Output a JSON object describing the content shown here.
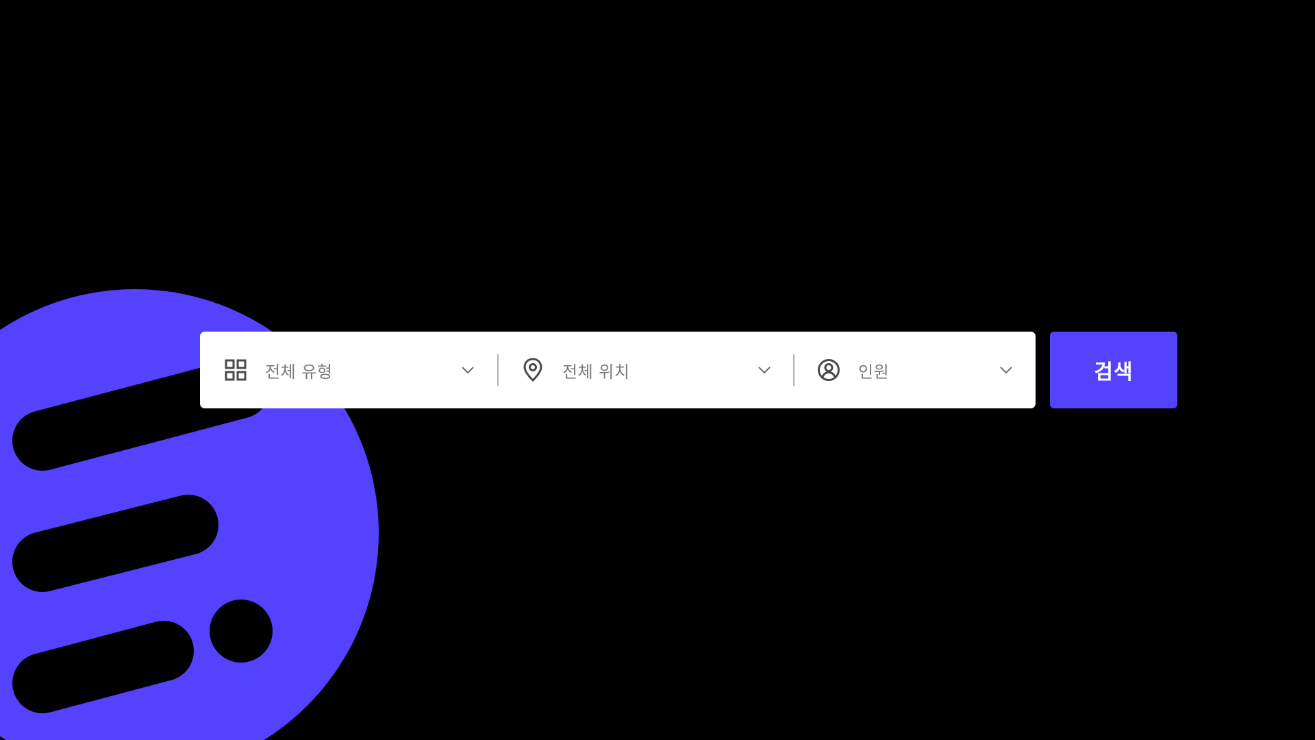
{
  "colors": {
    "background": "#000000",
    "accent": "#5442ff",
    "search_bar": "#ffffff",
    "placeholder_text": "#7b7b7b",
    "icon": "#4a4a4a",
    "divider": "#b3b3b3"
  },
  "search": {
    "type_field": {
      "label": "전체 유형",
      "icon": "grid-icon"
    },
    "location_field": {
      "label": "전체 위치",
      "icon": "map-pin-icon"
    },
    "people_field": {
      "label": "인원",
      "icon": "user-circle-icon"
    },
    "submit_label": "검색"
  },
  "brand_logo": {
    "shape": "circle-with-stripes-and-dot"
  }
}
